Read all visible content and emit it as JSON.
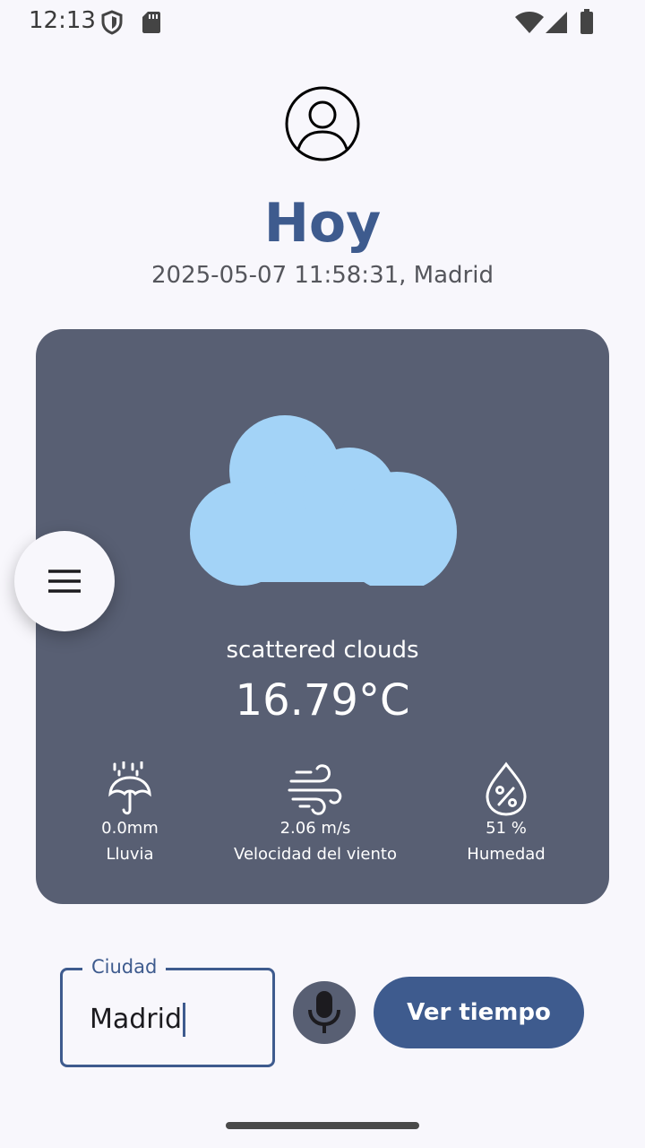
{
  "status_bar": {
    "time": "12:13",
    "icons": [
      "shield-icon",
      "sd-card-icon",
      "wifi-icon",
      "signal-icon",
      "battery-icon"
    ]
  },
  "header": {
    "avatar_icon": "account-circle-icon",
    "title": "Hoy",
    "subtitle": "2025-05-07 11:58:31, Madrid"
  },
  "weather": {
    "icon": "cloud-icon",
    "description": "scattered clouds",
    "temperature": "16.79°C",
    "stats": [
      {
        "icon": "umbrella-rain-icon",
        "value": "0.0mm",
        "label": "Lluvia"
      },
      {
        "icon": "wind-icon",
        "value": "2.06 m/s",
        "label": "Velocidad del viento"
      },
      {
        "icon": "humidity-icon",
        "value": "51 %",
        "label": "Humedad"
      }
    ]
  },
  "menu": {
    "icon": "menu-icon"
  },
  "search": {
    "label": "Ciudad",
    "value": "Madrid",
    "mic_icon": "microphone-icon",
    "button_label": "Ver tiempo"
  },
  "colors": {
    "primary": "#3e5b8e",
    "card": "#585f73",
    "background": "#f8f7fc",
    "cloud": "#a3d3f7"
  }
}
